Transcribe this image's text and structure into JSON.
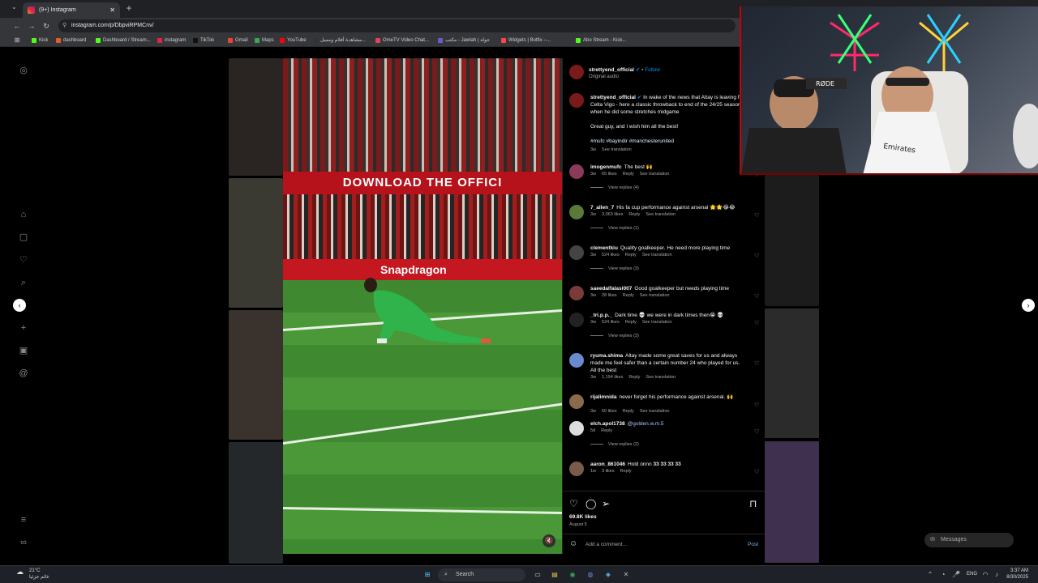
{
  "browser": {
    "tab_title": "(9+) Instagram",
    "url": "instagram.com/p/DbpviRPMCnv/",
    "bookmarks": [
      {
        "label": "Kick",
        "color": "#53fc18"
      },
      {
        "label": "dashboard",
        "color": "#e35b2b"
      },
      {
        "label": "Dashboard / Stream...",
        "color": "#53fc18"
      },
      {
        "label": "instagram",
        "color": "#dc2743"
      },
      {
        "label": "TikTok",
        "color": "#111111"
      },
      {
        "label": "Gmail",
        "color": "#ea4335"
      },
      {
        "label": "Maps",
        "color": "#34a853"
      },
      {
        "label": "YouTube",
        "color": "#ff0000"
      },
      {
        "label": "مشاهدة أفلام ومسل...",
        "color": "#333333"
      },
      {
        "label": "OmeTV Video Chat...",
        "color": "#e4405f"
      },
      {
        "label": "مكتب - Jawlah | جولة",
        "color": "#6a5acd"
      },
      {
        "label": "Widgets | Botfix --...",
        "color": "#ff4444"
      },
      {
        "label": "Abo Stream - Kick...",
        "color": "#53fc18"
      }
    ]
  },
  "post": {
    "username": "strettyend_official",
    "follow_label": "Follow",
    "audio": "Original audio",
    "caption": "In wake of the news that Altay is leaving for Celta Vigo - here a classic throwback to end of the 24/25 season when he did some stretches midgame",
    "caption_extra": "Great guy, and I wish him all the best!",
    "hashtags": "#mufc #bayindir #manchesterunited",
    "caption_meta_time": "3w",
    "caption_meta_translation": "See translation",
    "banner_text": "DOWNLOAD THE OFFICI",
    "adboard_text": "Snapdragon",
    "likes": "69.8K likes",
    "date": "August 5",
    "comment_placeholder": "Add a comment...",
    "post_label": "Post"
  },
  "comments": [
    {
      "user": "imogenmufc",
      "text": "The best 🙌",
      "time": "3w",
      "likes": "65 likes",
      "reply": "Reply",
      "translate": "See translation",
      "replies": "View replies (4)",
      "avatar_color": "#8a3a5a"
    },
    {
      "user": "7_allen_7",
      "text": "His fa cup performance against arsenal 🌟🌟😂😂",
      "time": "3w",
      "likes": "3,063 likes",
      "reply": "Reply",
      "translate": "See translation",
      "replies": "View replies (1)",
      "avatar_color": "#5a7a3a"
    },
    {
      "user": "clementkiu",
      "text": "Quality goalkeeper. He need more playing time",
      "time": "3w",
      "likes": "524 likes",
      "reply": "Reply",
      "translate": "See translation",
      "replies": "View replies (3)",
      "avatar_color": "#444444"
    },
    {
      "user": "saeedalfalasi007",
      "text": "Good goalkeeper but needs playing time",
      "time": "3w",
      "likes": "28 likes",
      "reply": "Reply",
      "translate": "See translation",
      "replies": "",
      "avatar_color": "#7a3a3a"
    },
    {
      "user": "_tri.p.p._",
      "text": "Dark time 💀 we were in dark times then😭 💀",
      "time": "3w",
      "likes": "524 likes",
      "reply": "Reply",
      "translate": "See translation",
      "replies": "View replies (3)",
      "avatar_color": "#222222"
    },
    {
      "user": "ryuma.shima",
      "text": "Altay made some great saves for us and always made me feel safer than a certain number 24 who played for us. All the best",
      "time": "3w",
      "likes": "1,194 likes",
      "reply": "Reply",
      "translate": "See translation",
      "replies": "",
      "avatar_color": "#6a8ad0"
    },
    {
      "user": "rijalimnida",
      "text": "never forget his performance against arsenal. 🙌",
      "time": "3w",
      "likes": "60 likes",
      "reply": "Reply",
      "translate": "See translation",
      "replies": "",
      "avatar_color": "#8a6a4a"
    },
    {
      "user": "elch.apol1738",
      "text": "@golden.w.m.5",
      "time": "5d",
      "likes": "",
      "reply": "Reply",
      "translate": "",
      "replies": "View replies (2)",
      "avatar_color": "#dddddd"
    },
    {
      "user": "aaron_861046",
      "text": "Hold onnn 𝟑𝟑 𝟑𝟑 𝟑𝟑 𝟑𝟑",
      "time": "1w",
      "likes": "3 likes",
      "reply": "Reply",
      "translate": "",
      "replies": "",
      "avatar_color": "#7a5a4a"
    }
  ],
  "right_ui": {
    "messages_label": "Messages"
  },
  "taskbar": {
    "weather_temp": "21°C",
    "weather_desc": "غائم جزئيا",
    "search_label": "Search",
    "lang": "ENG",
    "time": "3:37 AM",
    "date": "8/30/2025"
  },
  "icons": {
    "instagram": "instagram-icon",
    "home": "home-icon",
    "reels": "reels-icon",
    "notifications": "heart-icon",
    "search": "search-icon",
    "create": "plus-icon",
    "dashboard": "dashboard-icon",
    "threads": "threads-icon",
    "menu": "menu-icon",
    "meta": "meta-icon"
  },
  "colors": {
    "brand_blue": "#0095f6",
    "banner_red": "#b5121b",
    "pitch_green": "#3f8a30"
  }
}
